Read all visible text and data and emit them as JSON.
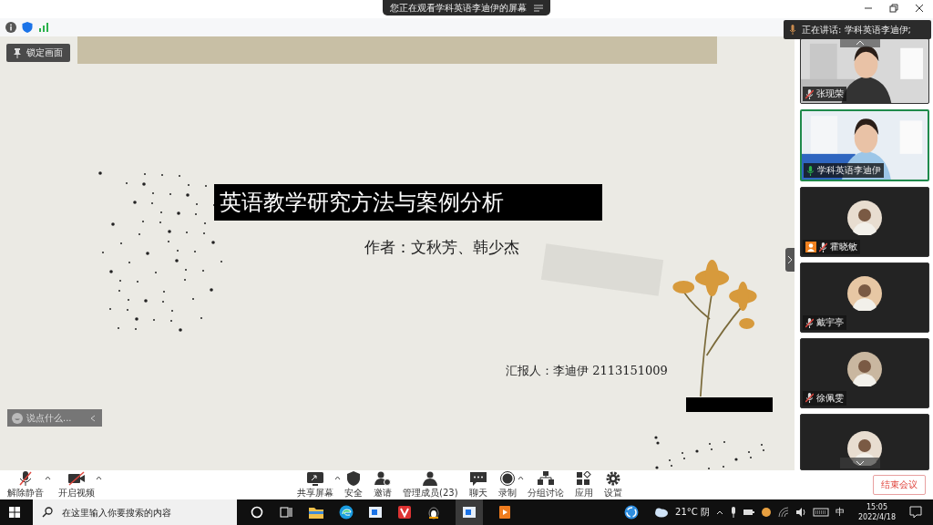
{
  "banner": {
    "text": "您正在观看学科英语李迪伊的屏幕"
  },
  "pin_button": {
    "label": "锁定画面"
  },
  "speaker_tooltip": {
    "text": "正在讲话: 学科英语李迪伊;"
  },
  "slide": {
    "title": "英语教学研究方法与案例分析",
    "author": "作者：文秋芳、韩少杰",
    "reporter": "汇报人：李迪伊 2113151009"
  },
  "chat_input": {
    "placeholder": "说点什么..."
  },
  "participants": [
    {
      "name": "张现荣",
      "kind": "video",
      "active": false,
      "muted": true,
      "host": false
    },
    {
      "name": "学科英语李迪伊",
      "kind": "video",
      "active": true,
      "muted": false,
      "host": false
    },
    {
      "name": "霍晓敏",
      "kind": "avatar",
      "active": false,
      "muted": true,
      "host": true
    },
    {
      "name": "戴宇亭",
      "kind": "avatar",
      "active": false,
      "muted": true,
      "host": false
    },
    {
      "name": "徐佩雯",
      "kind": "avatar",
      "active": false,
      "muted": true,
      "host": false
    },
    {
      "kind": "avatar",
      "active": false
    }
  ],
  "toolbar_left": [
    {
      "label": "解除静音"
    },
    {
      "label": "开启视频"
    }
  ],
  "toolbar_center": [
    {
      "label": "共享屏幕"
    },
    {
      "label": "安全"
    },
    {
      "label": "邀请"
    },
    {
      "label": "管理成员(23)"
    },
    {
      "label": "聊天"
    },
    {
      "label": "录制"
    },
    {
      "label": "分组讨论"
    },
    {
      "label": "应用"
    },
    {
      "label": "设置"
    }
  ],
  "end_button": {
    "label": "结束会议"
  },
  "taskbar": {
    "search_placeholder": "在这里输入你要搜索的内容",
    "weather": "21°C 阴",
    "ime": "中",
    "time": "15:05",
    "date": "2022/4/18"
  }
}
